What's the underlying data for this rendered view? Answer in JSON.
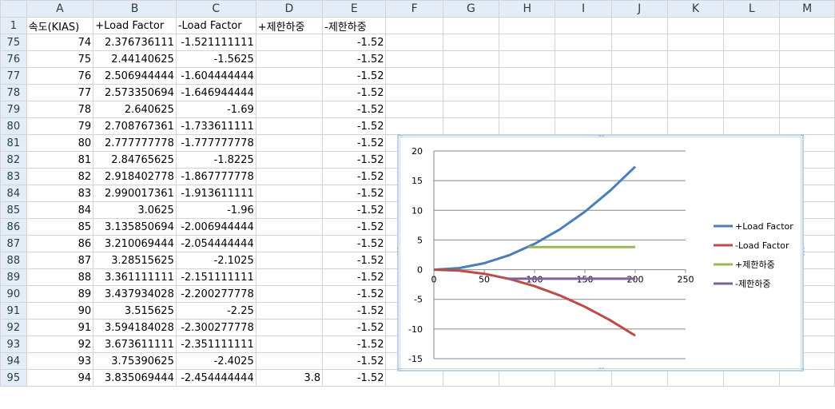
{
  "columns": [
    "",
    "A",
    "B",
    "C",
    "D",
    "E",
    "F",
    "G",
    "H",
    "I",
    "J",
    "K",
    "L",
    "M"
  ],
  "header_row": {
    "num": "1",
    "a": "속도(KIAS)",
    "b": "+Load Factor",
    "c": "-Load Factor",
    "d": "+제한하중",
    "e": "-제한하중"
  },
  "rows": [
    {
      "num": "75",
      "a": "74",
      "b": "2.376736111",
      "c": "-1.521111111",
      "d": "",
      "e": "-1.52"
    },
    {
      "num": "76",
      "a": "75",
      "b": "2.44140625",
      "c": "-1.5625",
      "d": "",
      "e": "-1.52"
    },
    {
      "num": "77",
      "a": "76",
      "b": "2.506944444",
      "c": "-1.604444444",
      "d": "",
      "e": "-1.52"
    },
    {
      "num": "78",
      "a": "77",
      "b": "2.573350694",
      "c": "-1.646944444",
      "d": "",
      "e": "-1.52"
    },
    {
      "num": "79",
      "a": "78",
      "b": "2.640625",
      "c": "-1.69",
      "d": "",
      "e": "-1.52"
    },
    {
      "num": "80",
      "a": "79",
      "b": "2.708767361",
      "c": "-1.733611111",
      "d": "",
      "e": "-1.52"
    },
    {
      "num": "81",
      "a": "80",
      "b": "2.777777778",
      "c": "-1.777777778",
      "d": "",
      "e": "-1.52"
    },
    {
      "num": "82",
      "a": "81",
      "b": "2.84765625",
      "c": "-1.8225",
      "d": "",
      "e": "-1.52"
    },
    {
      "num": "83",
      "a": "82",
      "b": "2.918402778",
      "c": "-1.867777778",
      "d": "",
      "e": "-1.52"
    },
    {
      "num": "84",
      "a": "83",
      "b": "2.990017361",
      "c": "-1.913611111",
      "d": "",
      "e": "-1.52"
    },
    {
      "num": "85",
      "a": "84",
      "b": "3.0625",
      "c": "-1.96",
      "d": "",
      "e": "-1.52"
    },
    {
      "num": "86",
      "a": "85",
      "b": "3.135850694",
      "c": "-2.006944444",
      "d": "",
      "e": "-1.52"
    },
    {
      "num": "87",
      "a": "86",
      "b": "3.210069444",
      "c": "-2.054444444",
      "d": "",
      "e": "-1.52"
    },
    {
      "num": "88",
      "a": "87",
      "b": "3.28515625",
      "c": "-2.1025",
      "d": "",
      "e": "-1.52"
    },
    {
      "num": "89",
      "a": "88",
      "b": "3.361111111",
      "c": "-2.151111111",
      "d": "",
      "e": "-1.52"
    },
    {
      "num": "90",
      "a": "89",
      "b": "3.437934028",
      "c": "-2.200277778",
      "d": "",
      "e": "-1.52"
    },
    {
      "num": "91",
      "a": "90",
      "b": "3.515625",
      "c": "-2.25",
      "d": "",
      "e": "-1.52"
    },
    {
      "num": "92",
      "a": "91",
      "b": "3.594184028",
      "c": "-2.300277778",
      "d": "",
      "e": "-1.52"
    },
    {
      "num": "93",
      "a": "92",
      "b": "3.673611111",
      "c": "-2.351111111",
      "d": "",
      "e": "-1.52"
    },
    {
      "num": "94",
      "a": "93",
      "b": "3.75390625",
      "c": "-2.4025",
      "d": "",
      "e": "-1.52"
    },
    {
      "num": "95",
      "a": "94",
      "b": "3.835069444",
      "c": "-2.454444444",
      "d": "3.8",
      "e": "-1.52"
    }
  ],
  "chart_data": {
    "type": "line",
    "title": "",
    "xlabel": "",
    "ylabel": "",
    "xlim": [
      0,
      250
    ],
    "ylim": [
      -15,
      20
    ],
    "xticks": [
      "0",
      "50",
      "100",
      "150",
      "200",
      "250"
    ],
    "yticks": [
      "20",
      "15",
      "10",
      "5",
      "0",
      "-5",
      "-10",
      "-15"
    ],
    "grid": "horizontal",
    "legend_position": "right",
    "series": [
      {
        "name": "+Load Factor",
        "color": "#4a7ebb",
        "formula_note": "y = (x/48)^2",
        "x": [
          0,
          25,
          50,
          75,
          100,
          125,
          150,
          175,
          200
        ],
        "y": [
          0,
          0.27,
          1.09,
          2.44,
          4.34,
          6.78,
          9.77,
          13.29,
          17.36
        ]
      },
      {
        "name": "-Load Factor",
        "color": "#be4b48",
        "x": [
          0,
          25,
          50,
          75,
          100,
          125,
          150,
          175,
          200
        ],
        "y": [
          0,
          -0.17,
          -0.69,
          -1.56,
          -2.78,
          -4.34,
          -6.25,
          -8.51,
          -11.11
        ]
      },
      {
        "name": "+제한하중",
        "color": "#98b954",
        "x": [
          94,
          200
        ],
        "y": [
          3.8,
          3.8
        ]
      },
      {
        "name": "-제한하중",
        "color": "#7d60a0",
        "x": [
          74,
          200
        ],
        "y": [
          -1.52,
          -1.52
        ]
      }
    ]
  }
}
